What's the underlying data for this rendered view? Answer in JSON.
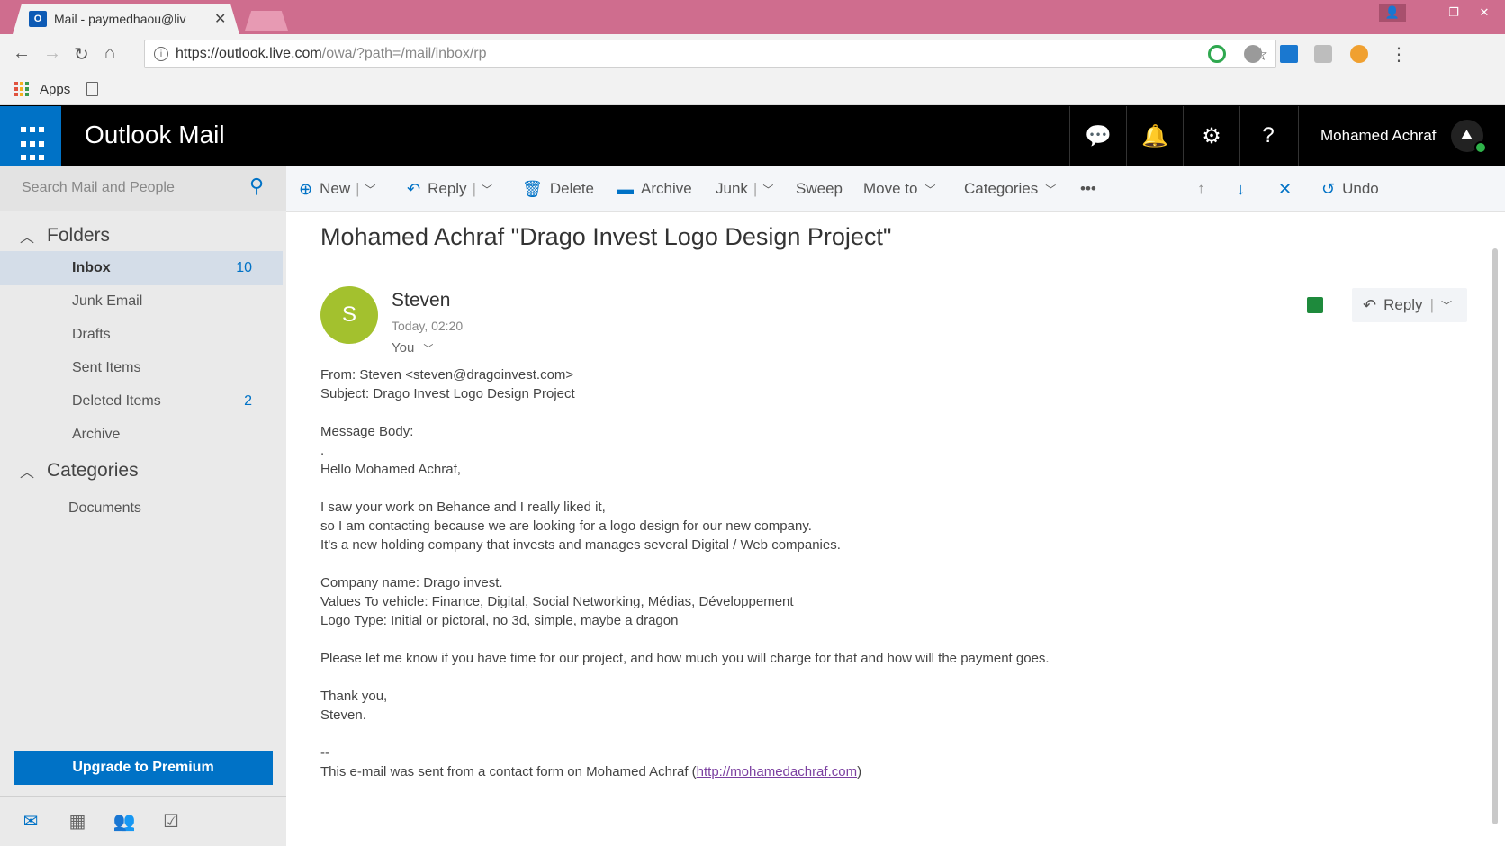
{
  "browser": {
    "tab_title": "Mail - paymedhaou@liv",
    "tab_favicon": "O",
    "url_domain": "https://outlook.live.com",
    "url_path": "/owa/?path=/mail/inbox/rp",
    "bookmarks_apps_label": "Apps"
  },
  "header": {
    "app_title": "Outlook Mail",
    "user_name": "Mohamed Achraf",
    "accent": "#0072c6"
  },
  "search": {
    "placeholder": "Search Mail and People"
  },
  "folders": {
    "section_label": "Folders",
    "items": [
      {
        "label": "Inbox",
        "count": "10"
      },
      {
        "label": "Junk Email",
        "count": ""
      },
      {
        "label": "Drafts",
        "count": ""
      },
      {
        "label": "Sent Items",
        "count": ""
      },
      {
        "label": "Deleted Items",
        "count": "2"
      },
      {
        "label": "Archive",
        "count": ""
      }
    ]
  },
  "categories": {
    "section_label": "Categories",
    "items": [
      {
        "label": "Documents"
      }
    ]
  },
  "upgrade_label": "Upgrade to Premium",
  "commands": {
    "new": "New",
    "reply": "Reply",
    "delete": "Delete",
    "archive": "Archive",
    "junk": "Junk",
    "sweep": "Sweep",
    "move_to": "Move to",
    "categories": "Categories",
    "more": "•••",
    "undo": "Undo"
  },
  "message": {
    "subject": "Mohamed Achraf \"Drago Invest Logo Design Project\"",
    "sender_initial": "S",
    "sender_name": "Steven",
    "date": "Today, 02:20",
    "to": "You",
    "reply_label": "Reply",
    "body": {
      "from_line": "From: Steven <steven@dragoinvest.com>",
      "subject_line": "Subject: Drago Invest Logo Design Project",
      "body_label": "Message Body:",
      "dot": ".",
      "greeting": "Hello Mohamed Achraf,",
      "para1_line1": "I saw your work on Behance and I really liked it,",
      "para1_line2": "so I am contacting because we are looking for a logo design for our new company.",
      "para1_line3": "It's a new holding company that invests and manages several Digital / Web companies.",
      "company_line": "Company name: Drago invest.",
      "values_line": "Values To vehicle: Finance, Digital, Social Networking, Médias, Développement",
      "logo_line": "Logo Type: Initial or pictoral, no 3d, simple, maybe a dragon",
      "please_line": "Please let me know if you have time for our project, and how much you will charge for that and how will the payment goes.",
      "thanks": "Thank you,",
      "signature": "Steven.",
      "dashes": "--",
      "footer_prefix": "This e-mail was sent from a contact form on Mohamed Achraf (",
      "footer_link": "http://mohamedachraf.com",
      "footer_suffix": ")"
    }
  }
}
